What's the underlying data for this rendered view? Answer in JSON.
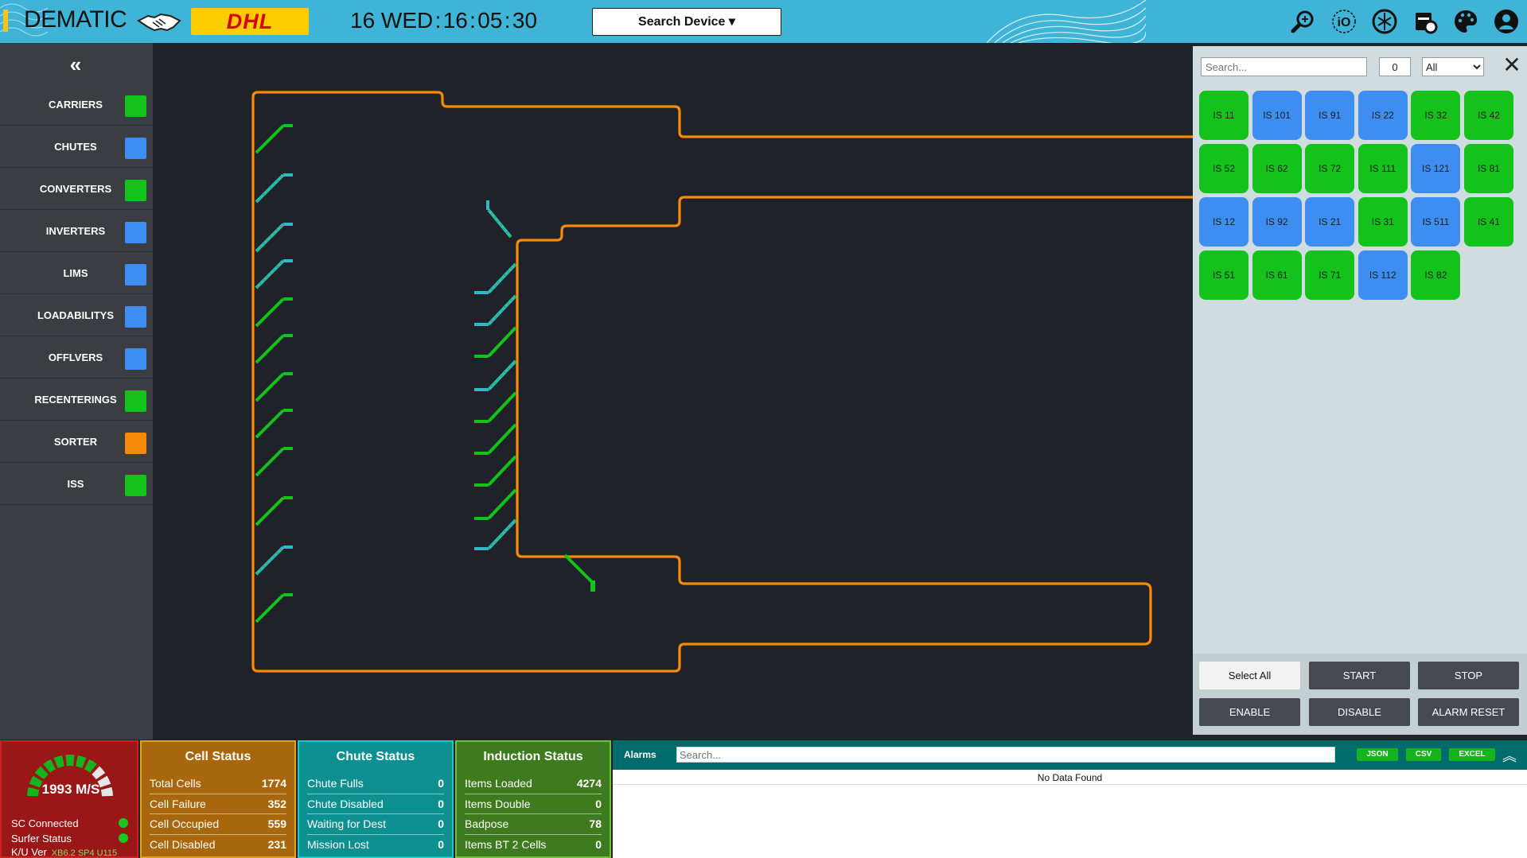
{
  "header": {
    "brand": "DEMATIC",
    "partner_logo": "DHL",
    "clock": "16 WED : 16 : 05 : 30",
    "search_device_label": "Search Device ▾",
    "icons": [
      "wrench-search-icon",
      "io-icon",
      "network-icon",
      "calendar-settings-icon",
      "palette-icon",
      "user-icon"
    ],
    "accent_color": "#3fb4d6"
  },
  "sidebar": {
    "collapse_icon": "double-chevron-left-icon",
    "items": [
      {
        "label": "CARRIERS",
        "color": "#13c21a"
      },
      {
        "label": "CHUTES",
        "color": "#3d8ef0"
      },
      {
        "label": "CONVERTERS",
        "color": "#13c21a"
      },
      {
        "label": "INVERTERS",
        "color": "#3d8ef0"
      },
      {
        "label": "LIMS",
        "color": "#3d8ef0"
      },
      {
        "label": "LOADABILITYS",
        "color": "#3d8ef0"
      },
      {
        "label": "OFFLVERS",
        "color": "#3d8ef0"
      },
      {
        "label": "RECENTERINGS",
        "color": "#13c21a"
      },
      {
        "label": "SORTER",
        "color": "#f58a0b"
      },
      {
        "label": "ISS",
        "color": "#13c21a"
      }
    ]
  },
  "right_panel": {
    "search_placeholder": "Search...",
    "count": "0",
    "filter_selected": "All",
    "close_icon": "close-icon",
    "iss_items": [
      {
        "label": "IS 11",
        "color": "#13c21a"
      },
      {
        "label": "IS 101",
        "color": "#3d8ef0"
      },
      {
        "label": "IS 91",
        "color": "#3d8ef0"
      },
      {
        "label": "IS 22",
        "color": "#3d8ef0"
      },
      {
        "label": "IS 32",
        "color": "#13c21a"
      },
      {
        "label": "IS 42",
        "color": "#13c21a"
      },
      {
        "label": "IS 52",
        "color": "#13c21a"
      },
      {
        "label": "IS 62",
        "color": "#13c21a"
      },
      {
        "label": "IS 72",
        "color": "#13c21a"
      },
      {
        "label": "IS 111",
        "color": "#13c21a"
      },
      {
        "label": "IS 121",
        "color": "#3d8ef0"
      },
      {
        "label": "IS 81",
        "color": "#13c21a"
      },
      {
        "label": "IS 12",
        "color": "#3d8ef0"
      },
      {
        "label": "IS 92",
        "color": "#3d8ef0"
      },
      {
        "label": "IS 21",
        "color": "#3d8ef0"
      },
      {
        "label": "IS 31",
        "color": "#13c21a"
      },
      {
        "label": "IS 511",
        "color": "#3d8ef0"
      },
      {
        "label": "IS 41",
        "color": "#13c21a"
      },
      {
        "label": "IS 51",
        "color": "#13c21a"
      },
      {
        "label": "IS 61",
        "color": "#13c21a"
      },
      {
        "label": "IS 71",
        "color": "#13c21a"
      },
      {
        "label": "IS 112",
        "color": "#3d8ef0"
      },
      {
        "label": "IS 82",
        "color": "#13c21a"
      }
    ],
    "actions": {
      "select_all": "Select All",
      "start": "START",
      "stop": "STOP",
      "enable": "ENABLE",
      "disable": "DISABLE",
      "alarm_reset": "ALARM RESET"
    }
  },
  "status": {
    "speed": "1993 M/S",
    "sc_connected": "SC Connected",
    "surfer_status": "Surfer Status",
    "ku_label": "K/U Ver",
    "ku_version": "XB6.2 SP4 U115"
  },
  "cell_status": {
    "title": "Cell Status",
    "rows": [
      {
        "label": "Total Cells",
        "value": "1774"
      },
      {
        "label": "Cell Failure",
        "value": "352"
      },
      {
        "label": "Cell Occupied",
        "value": "559"
      },
      {
        "label": "Cell Disabled",
        "value": "231"
      }
    ]
  },
  "chute_status": {
    "title": "Chute Status",
    "rows": [
      {
        "label": "Chute Fulls",
        "value": "0"
      },
      {
        "label": "Chute Disabled",
        "value": "0"
      },
      {
        "label": "Waiting for Dest",
        "value": "0"
      },
      {
        "label": "Mission Lost",
        "value": "0"
      }
    ]
  },
  "induction_status": {
    "title": "Induction Status",
    "rows": [
      {
        "label": "Items Loaded",
        "value": "4274"
      },
      {
        "label": "Items Double",
        "value": "0"
      },
      {
        "label": "Badpose",
        "value": "78"
      },
      {
        "label": "Items BT 2 Cells",
        "value": "0"
      }
    ]
  },
  "alarms": {
    "title": "Alarms",
    "search_placeholder": "Search...",
    "export_json": "JSON",
    "export_csv": "CSV",
    "export_excel": "EXCEL",
    "toggle_icon": "double-chevron-up-icon",
    "empty_text": "No Data Found"
  }
}
